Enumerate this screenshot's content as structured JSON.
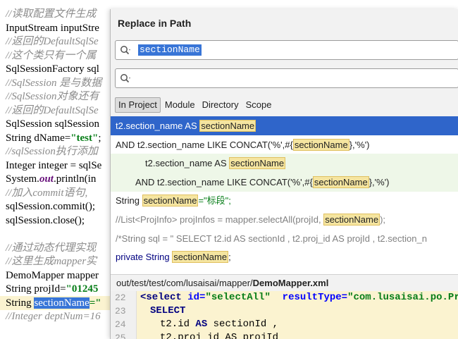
{
  "editor": {
    "lines": [
      {
        "text": "//读取配置文件生成",
        "style": "cmt"
      },
      {
        "text": "InputStream inputStre",
        "style": "code"
      },
      {
        "text": "//返回的DefaultSqlSe",
        "style": "cmt"
      },
      {
        "text": "//这个类只有一个属",
        "style": "cmt"
      },
      {
        "text": "SqlSessionFactory sql",
        "style": "code"
      },
      {
        "text": "//SqlSession 是与数据",
        "style": "cmt"
      },
      {
        "text": "//SqlSession对象还有",
        "style": "cmt"
      },
      {
        "text": "//返回的DefaultSqlSe",
        "style": "cmt"
      },
      {
        "text": "SqlSession sqlSession",
        "style": "code"
      },
      {
        "text": "String dName=",
        "style": "code",
        "str": "\"test\"",
        "tail": ";"
      },
      {
        "text": "//sqlSession执行添加",
        "style": "cmt"
      },
      {
        "text": "Integer integer = sqlSe",
        "style": "code"
      },
      {
        "text": "System.",
        "style": "code",
        "kw": "out",
        "tail": ".println(in"
      },
      {
        "text": "//加入commit语句,",
        "style": "cmt"
      },
      {
        "text": "sqlSession.commit();",
        "style": "code"
      },
      {
        "text": "sqlSession.close();",
        "style": "code"
      },
      {
        "text": "",
        "style": "code"
      },
      {
        "text": "//通过动态代理实现",
        "style": "cmt"
      },
      {
        "text": "//这里生成mapper实",
        "style": "cmt"
      },
      {
        "text": "DemoMapper mapper",
        "style": "code"
      },
      {
        "text": "String projId=",
        "style": "code",
        "str": "\"01245",
        "tail": ""
      },
      {
        "text": "String ",
        "style": "code",
        "sel": "sectionName",
        "tail": "=\""
      },
      {
        "text": "//Integer deptNum=16",
        "style": "cmt"
      }
    ]
  },
  "popup": {
    "title": "Replace in Path",
    "search_value": "sectionName",
    "replace_value": "",
    "scopes": [
      {
        "label": "In Project",
        "active": true
      },
      {
        "label": "Module",
        "active": false
      },
      {
        "label": "Directory",
        "active": false
      },
      {
        "label": "Scope",
        "active": false
      }
    ],
    "results": [
      {
        "pre": "t2.section_name AS ",
        "match": "sectionName",
        "post": "",
        "kind": "selected"
      },
      {
        "pre": "AND t2.section_name LIKE CONCAT('%',#{",
        "match": "sectionName",
        "post": "},'%')",
        "kind": "plain"
      },
      {
        "pre": "t2.section_name AS ",
        "match": "sectionName",
        "post": "",
        "kind": "shade-indent"
      },
      {
        "pre": "AND t2.section_name LIKE CONCAT('%',#{",
        "match": "sectionName",
        "post": "},'%')",
        "kind": "shade-indent2"
      },
      {
        "pre": "String ",
        "match": "sectionName",
        "post": "=\"标段\";",
        "kind": "string"
      },
      {
        "pre": "//List<ProjInfo> projInfos = mapper.selectAll(projId, ",
        "match": "sectionName",
        "post": ");",
        "kind": "comment"
      },
      {
        "pre": "/*String sql = \"  SELECT t2.id AS sectionId , t2.proj_id AS projId , t2.section_n",
        "match": "",
        "post": "",
        "kind": "comment"
      },
      {
        "pre": "private String ",
        "match": "sectionName",
        "post": ";",
        "kind": "private"
      }
    ],
    "path_prefix": "out/test/test/com/lusaisai/mapper/",
    "path_file": "DemoMapper.xml",
    "preview": {
      "line_numbers": [
        "22",
        "23",
        "24",
        "25"
      ],
      "line22": {
        "open": "<select ",
        "attr1": "id=",
        "val1": "\"selectAll\"",
        "attr2": "resultType=",
        "val2": "\"com.lusaisai.po.ProjInfo"
      },
      "line23": "SELECT",
      "line24": {
        "pre": "t2.id ",
        "kw": "AS",
        "post": " sectionId ,"
      },
      "line25": "t2.proj_id AS projId"
    }
  }
}
